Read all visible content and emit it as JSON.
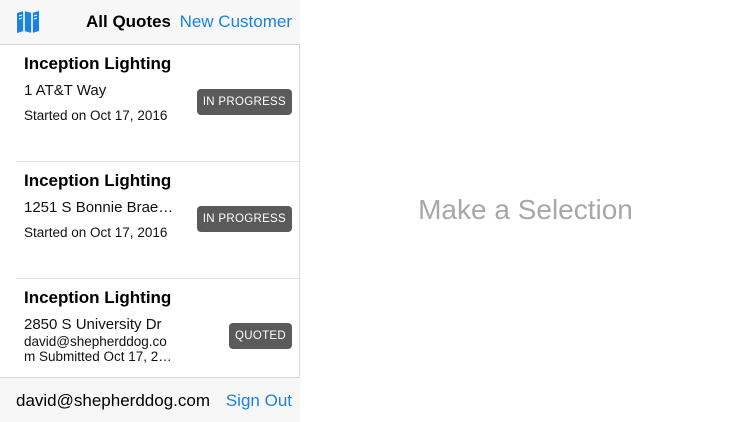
{
  "colors": {
    "accent": "#1a82e2",
    "badge": "#5a5a5a",
    "placeholder": "#a8a8a8"
  },
  "navbar": {
    "map_icon": "map-icon",
    "title": "All Quotes",
    "new_customer": "New Customer"
  },
  "quotes": [
    {
      "name": "Inception Lighting",
      "address": "1 AT&T Way",
      "meta": "Started on Oct 17, 2016",
      "status": "IN PROGRESS"
    },
    {
      "name": "Inception Lighting",
      "address": "1251 S Bonnie Brae…",
      "meta": "Started on Oct 17, 2016",
      "status": "IN PROGRESS"
    },
    {
      "name": "Inception Lighting",
      "address": "2850 S University Dr",
      "meta_line1": "david@shepherddog.co",
      "meta_line2": "m Submitted Oct 17, 2…",
      "status": "QUOTED"
    }
  ],
  "footer": {
    "email": "david@shepherddog.com",
    "sign_out": "Sign Out"
  },
  "detail": {
    "placeholder": "Make a Selection"
  }
}
